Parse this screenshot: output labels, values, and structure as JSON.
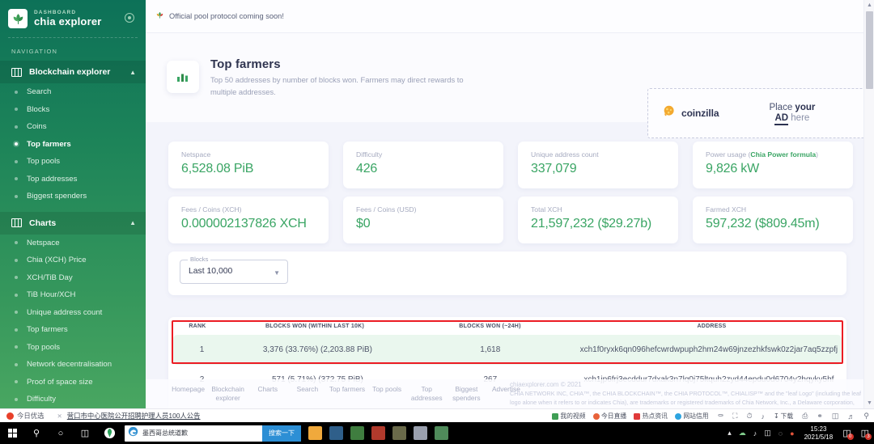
{
  "sidebar": {
    "brand": {
      "sub": "DASHBOARD",
      "name": "chia explorer",
      "logo_icon": "chia-leaf-logo",
      "toggle_icon": "circle-dot-icon"
    },
    "nav_caption": "NAVIGATION",
    "groups": [
      {
        "label": "Blockchain explorer",
        "icon": "grid-icon",
        "caret": "chevron-up-icon",
        "items": [
          {
            "label": "Search",
            "active": false
          },
          {
            "label": "Blocks",
            "active": false
          },
          {
            "label": "Coins",
            "active": false
          },
          {
            "label": "Top farmers",
            "active": true
          },
          {
            "label": "Top pools",
            "active": false
          },
          {
            "label": "Top addresses",
            "active": false
          },
          {
            "label": "Biggest spenders",
            "active": false
          }
        ]
      },
      {
        "label": "Charts",
        "icon": "grid-icon",
        "caret": "chevron-up-icon",
        "items": [
          {
            "label": "Netspace",
            "active": false
          },
          {
            "label": "Chia (XCH) Price",
            "active": false
          },
          {
            "label": "XCH/TiB Day",
            "active": false
          },
          {
            "label": "TiB Hour/XCH",
            "active": false
          },
          {
            "label": "Unique address count",
            "active": false
          },
          {
            "label": "Top farmers",
            "active": false
          },
          {
            "label": "Top pools",
            "active": false
          },
          {
            "label": "Network decentralisation",
            "active": false
          },
          {
            "label": "Proof of space size",
            "active": false
          },
          {
            "label": "Difficulty",
            "active": false
          }
        ]
      }
    ]
  },
  "notice": {
    "icon": "chia-leaf-icon",
    "text": "Official pool protocol coming soon!"
  },
  "header": {
    "icon": "bar-chart-icon",
    "title": "Top farmers",
    "description": "Top 50 addresses by number of blocks won. Farmers may direct rewards to multiple addresses."
  },
  "ad": {
    "brand_icon": "coinzilla-logo",
    "brand": "coinzilla",
    "line1_plain": "Place ",
    "line1_bold": "your",
    "line2_bold": "AD",
    "line2_plain": " here",
    "art_icon": "orange-triangle-art"
  },
  "stats": [
    {
      "label": "Netspace",
      "value": "6,528.08 PiB"
    },
    {
      "label": "Difficulty",
      "value": "426"
    },
    {
      "label": "Unique address count",
      "value": "337,079"
    },
    {
      "label_pre": "Power usage (",
      "label_link": "Chia Power formula",
      "label_post": ")",
      "value": "9,826 kW"
    },
    {
      "label": "Fees / Coins (XCH)",
      "value": "0.000002137826 XCH"
    },
    {
      "label": "Fees / Coins (USD)",
      "value": "$0"
    },
    {
      "label": "Total XCH",
      "value": "21,597,232 ($29.27b)"
    },
    {
      "label": "Farmed XCH",
      "value": "597,232 ($809.45m)"
    }
  ],
  "filter": {
    "legend": "Blocks",
    "value": "Last 10,000",
    "caret_icon": "chevron-down-icon"
  },
  "table": {
    "columns": [
      "RANK",
      "BLOCKS WON (WITHIN LAST 10K)",
      "BLOCKS WON (~24H)",
      "ADDRESS"
    ],
    "rows": [
      {
        "rank": "1",
        "blocks_won": "3,376 (33.76%) (2,203.88 PiB)",
        "blocks_24h": "1,618",
        "address": "xch1f0ryxk6qn096hefcwrdwpuph2hm24w69jnzezhkfswk0z2jar7aq5zzpfj",
        "highlighted": true
      },
      {
        "rank": "2",
        "blocks_won": "571 (5.71%) (372.75 PiB)",
        "blocks_24h": "267",
        "address": "xch1jp6frj3ecddur7dxak3n7lq0j75ltquh2zyd44epdu0d6704y2hqyky5hf",
        "highlighted": false
      }
    ]
  },
  "footer": {
    "links": [
      "Homepage",
      "Blockchain explorer",
      "Charts",
      "Search",
      "Top farmers",
      "Top pools",
      "Top addresses",
      "Biggest spenders",
      "Advertise"
    ],
    "copyright": "chiaexplorer.com © 2021",
    "legal": "CHIA NETWORK INC, CHIA™, the CHIA BLOCKCHAIN™, the CHIA PROTOCOL™, CHIALISP™ and the \"leaf Logo\" (including the leaf logo alone when it refers to or indicates Chia), are trademarks or registered trademarks of Chia Network, Inc., a Delaware corporation, used under license."
  },
  "scrollbar": {
    "up_icon": "scroll-up-arrow",
    "down_icon": "scroll-down-arrow"
  },
  "browser_bar": {
    "badge_label": "今日优选",
    "close_icon": "close-x-icon",
    "news_link": "营口市中心医院公开招聘护理人员100人公告",
    "tools": [
      {
        "label": "我的视频",
        "color": "#3f9e55"
      },
      {
        "label": "今日直播",
        "color": "#e8623a"
      },
      {
        "label": "热点资讯",
        "color": "#e03a3a"
      },
      {
        "label": "网站信用",
        "color": "#2da4e0"
      }
    ],
    "icons": [
      "shield-icon",
      "screenshot-icon",
      "history-icon",
      "mute-icon",
      "download-icon",
      "print-icon",
      "link-icon",
      "window-icon",
      "volume-icon",
      "search-icon"
    ],
    "download_label": "下载"
  },
  "taskbar": {
    "start_icon": "windows-start-icon",
    "search_icon": "search-icon",
    "cortana_icon": "cortana-circle-icon",
    "taskview_icon": "task-view-icon",
    "app_icon": "360-browser-icon",
    "active_window": {
      "icon": "edge-browser-icon",
      "title": "墨西哥总统道歉",
      "button_label": "搜索一下"
    },
    "pinned": [
      "file-explorer-icon",
      "app-icon-1",
      "app-icon-2",
      "app-icon-3",
      "app-icon-4",
      "app-icon-5",
      "app-icon-6"
    ],
    "tray": {
      "chevron_icon": "show-hidden-icons",
      "cloud_icon": "onedrive-icon",
      "volume_icon": "volume-muted-icon",
      "network_icon": "network-icon",
      "action_icon": "security-icon",
      "app_icon": "tray-app-icon"
    },
    "clock": {
      "time": "15:23",
      "date": "2021/5/18"
    },
    "notifications": [
      {
        "icon": "messages-icon",
        "count": "0"
      },
      {
        "icon": "chat-icon",
        "count": "3"
      }
    ]
  }
}
